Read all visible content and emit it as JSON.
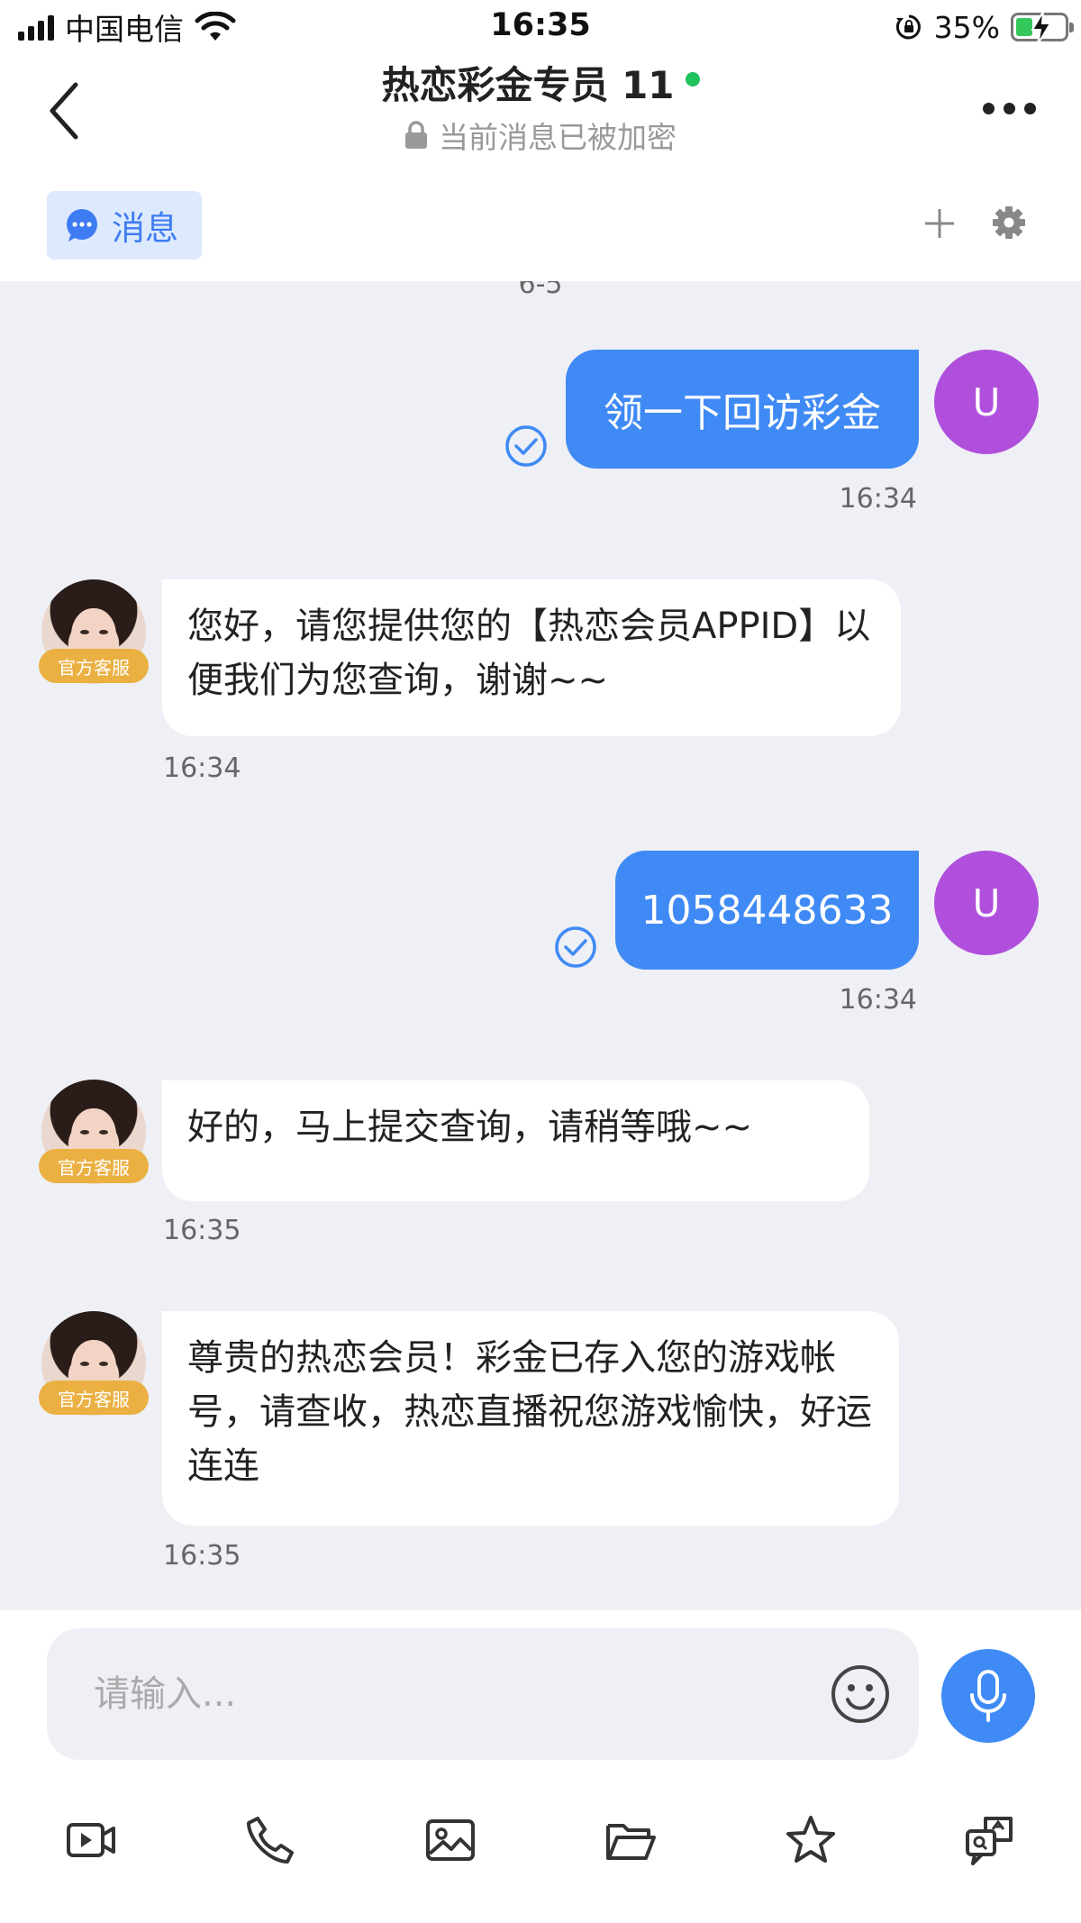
{
  "status_bar": {
    "carrier": "中国电信",
    "time": "16:35",
    "battery": "35%",
    "battery_level": 0.35
  },
  "header": {
    "title": "热恋彩金专员 11",
    "online": true,
    "subtitle": "当前消息已被加密"
  },
  "tabs": {
    "active_label": "消息"
  },
  "chat": {
    "date_separator": "6-5",
    "messages": [
      {
        "side": "out",
        "text": "领一下回访彩金",
        "time": "16:34",
        "avatar": "U"
      },
      {
        "side": "in",
        "text": "您好，请您提供您的【热恋会员APPID】以便我们为您查询，谢谢~~",
        "time": "16:34",
        "badge": "官方客服"
      },
      {
        "side": "out",
        "text": "1058448633",
        "time": "16:34",
        "avatar": "U"
      },
      {
        "side": "in",
        "text": "好的，马上提交查询，请稍等哦~~",
        "time": "16:35",
        "badge": "官方客服"
      },
      {
        "side": "in",
        "text": "尊贵的热恋会员！彩金已存入您的游戏帐号，请查收，热恋直播祝您游戏愉快，好运连连",
        "time": "16:35",
        "badge": "官方客服"
      }
    ]
  },
  "composer": {
    "placeholder": "请输入..."
  },
  "toolbar_icons": [
    "video-icon",
    "phone-icon",
    "image-icon",
    "folder-icon",
    "star-icon",
    "translate-icon"
  ],
  "colors": {
    "accent": "#3f8af5",
    "user_avatar": "#b04fdc",
    "badge": "#ebb042",
    "online": "#1fc25b"
  }
}
